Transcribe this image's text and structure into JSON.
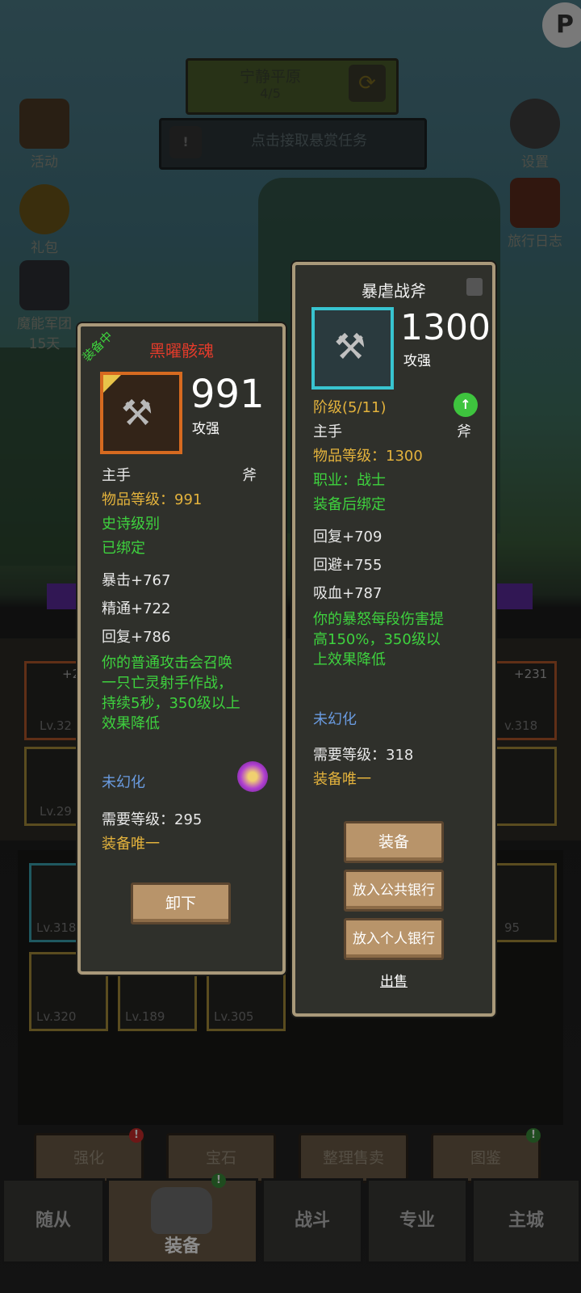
{
  "top": {
    "zone_name": "宁静平原",
    "zone_progress": "4/5",
    "bounty_text": "点击接取悬赏任务",
    "fly_icon": "P"
  },
  "side_left": [
    {
      "label": "活动"
    },
    {
      "label": "礼包"
    },
    {
      "label": "魔能军团",
      "sub": "15天"
    }
  ],
  "side_right": [
    {
      "label": "设置"
    },
    {
      "label": "旅行日志"
    }
  ],
  "equipped_item": {
    "status_tag": "装备中",
    "name": "黑曜骸魂",
    "name_color": "#e23b2b",
    "power": "991",
    "power_label": "攻强",
    "slot": "主手",
    "type": "斧",
    "item_level": "物品等级：991",
    "rarity": "史诗级别",
    "bound": "已绑定",
    "stats": [
      "暴击+767",
      "精通+722",
      "回复+786"
    ],
    "effect": "你的普通攻击会召唤一只亡灵射手作战，持续5秒，350级以上效果降低",
    "transmog": "未幻化",
    "required_level": "需要等级：295",
    "unique": "装备唯一",
    "unequip_button": "卸下"
  },
  "new_item": {
    "name": "暴虐战斧",
    "power": "1300",
    "power_label": "攻强",
    "tier": "阶级(5/11)",
    "slot": "主手",
    "type": "斧",
    "item_level": "物品等级：1300",
    "class": "职业：战士",
    "bind": "装备后绑定",
    "stats": [
      "回复+709",
      "回避+755",
      "吸血+787"
    ],
    "effect": "你的暴怒每段伤害提高150%，350级以上效果降低",
    "transmog": "未幻化",
    "required_level": "需要等级：318",
    "unique": "装备唯一",
    "equip_button": "装备",
    "public_bank_button": "放入公共银行",
    "personal_bank_button": "放入个人银行",
    "sell_link": "出售"
  },
  "inventory_labels": {
    "slot1_plus": "+2",
    "slot1_lv": "Lv.32",
    "slot2_lv": "Lv.29",
    "right1_plus": "+231",
    "right1_lv": "v.318",
    "row2_a": "Lv.318",
    "row2_b": "95",
    "row3_a": "Lv.320",
    "row3_b": "Lv.189",
    "row3_c": "Lv.305"
  },
  "tools": [
    "强化",
    "宝石",
    "整理售卖",
    "图鉴"
  ],
  "tabs": [
    "随从",
    "装备",
    "战斗",
    "专业",
    "主城"
  ],
  "colors": {
    "epic_red": "#e23b2b",
    "legend_gold": "#e3b23c",
    "green": "#3ed23e",
    "blue": "#6a9be0"
  }
}
